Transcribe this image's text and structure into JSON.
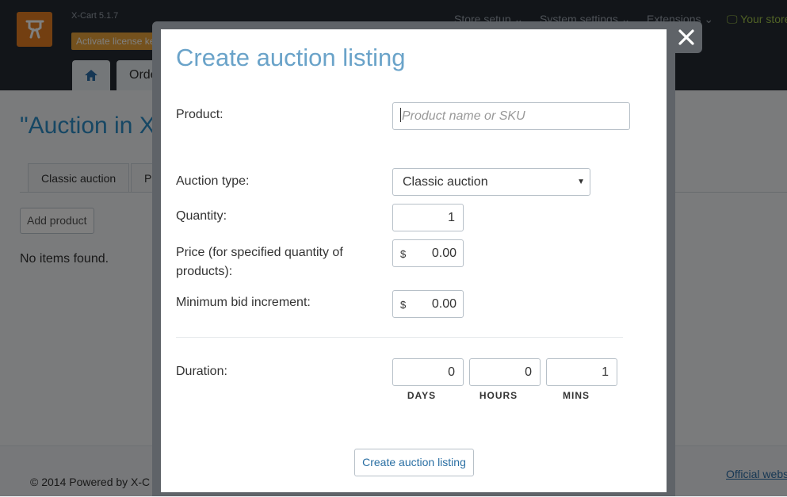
{
  "app": {
    "version": "X-Cart 5.1.7",
    "license_button": "Activate license key",
    "nav": {
      "store_setup": "Store setup",
      "system_settings": "System settings",
      "extensions": "Extensions",
      "your_store": "Your store"
    },
    "tabs": {
      "orders": "Orders"
    }
  },
  "page": {
    "title": "\"Auction in X",
    "tabs": [
      "Classic auction",
      "P"
    ],
    "add_product": "Add product",
    "empty_message": "No items found."
  },
  "footer": {
    "copyright": "© 2014 Powered by X-C",
    "official_link": "Official webs"
  },
  "modal": {
    "title": "Create auction listing",
    "product_label": "Product:",
    "product_placeholder": "Product name or SKU",
    "auction_type_label": "Auction type:",
    "auction_type_value": "Classic auction",
    "quantity_label": "Quantity:",
    "quantity_value": "1",
    "price_label": "Price (for specified quantity of products):",
    "price_currency": "$",
    "price_value": "0.00",
    "min_bid_label": "Minimum bid increment:",
    "min_bid_currency": "$",
    "min_bid_value": "0.00",
    "duration_label": "Duration:",
    "duration": {
      "days_value": "0",
      "days_label": "DAYS",
      "hours_value": "0",
      "hours_label": "HOURS",
      "mins_value": "1",
      "mins_label": "MINS"
    },
    "submit_label": "Create auction listing"
  },
  "colors": {
    "accent": "#6aa3c9",
    "logo": "#e67e22",
    "topbar": "#242a33"
  },
  "icons": [
    "logo-icon",
    "home-icon",
    "monitor-icon",
    "close-icon",
    "chevron-down-icon"
  ]
}
